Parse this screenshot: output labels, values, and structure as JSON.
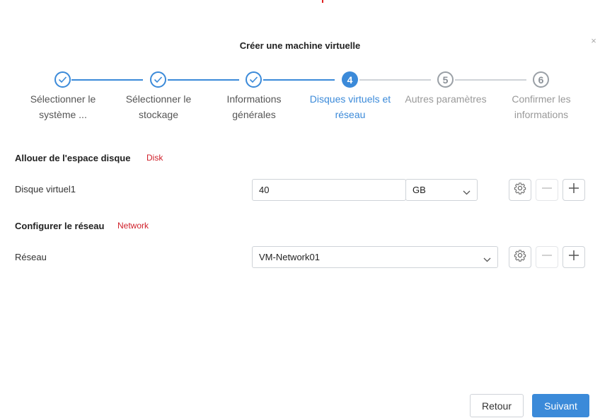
{
  "dialog": {
    "title": "Créer une machine virtuelle",
    "close_label": "×"
  },
  "stepper": {
    "steps": [
      {
        "number": "1",
        "line1": "Sélectionner le",
        "line2": "système ...",
        "state": "done"
      },
      {
        "number": "2",
        "line1": "Sélectionner le",
        "line2": "stockage",
        "state": "done"
      },
      {
        "number": "3",
        "line1": "Informations",
        "line2": "générales",
        "state": "done"
      },
      {
        "number": "4",
        "line1": "Disques virtuels et",
        "line2": "réseau",
        "state": "active"
      },
      {
        "number": "5",
        "line1": "Autres paramètres",
        "line2": "",
        "state": "todo"
      },
      {
        "number": "6",
        "line1": "Confirmer les",
        "line2": "informations",
        "state": "todo"
      }
    ]
  },
  "disk_section": {
    "title": "Allouer de l'espace disque",
    "tag": "Disk",
    "row_label": "Disque virtuel1",
    "size_value": "40",
    "unit_value": "GB"
  },
  "network_section": {
    "title": "Configurer le réseau",
    "tag": "Network",
    "row_label": "Réseau",
    "network_value": "VM-Network01"
  },
  "footer": {
    "back_label": "Retour",
    "next_label": "Suivant"
  },
  "colors": {
    "accent": "#3b8ad9",
    "tag_red": "#d0202a",
    "inactive": "#9aa0a6"
  },
  "icons": {
    "step_done": "check-icon",
    "settings": "gear-icon",
    "remove": "minus-icon",
    "add": "plus-icon",
    "dropdown": "chevron-down-icon",
    "close": "close-icon"
  }
}
